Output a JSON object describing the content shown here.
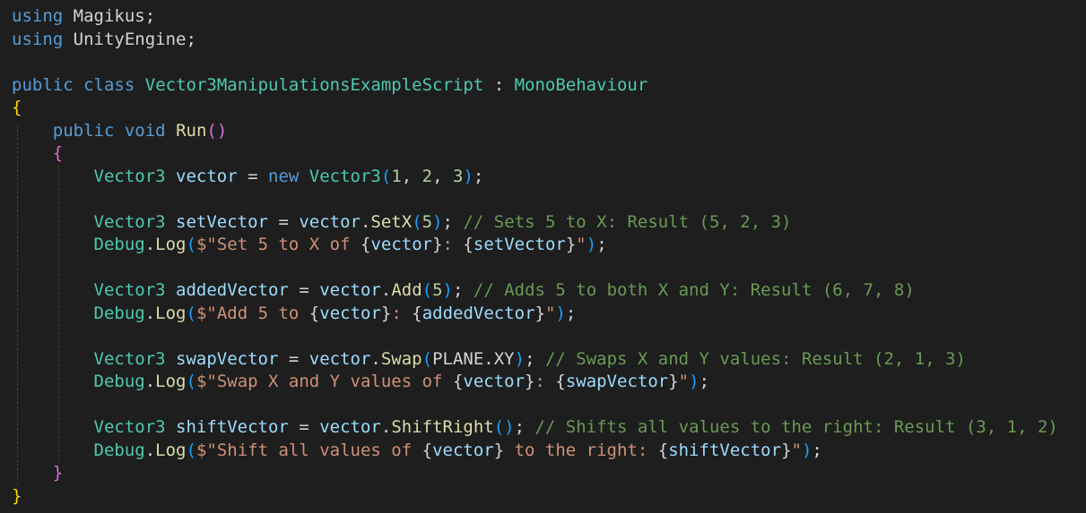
{
  "editor": {
    "background": "#1e1e1e",
    "language": "C#",
    "lines": [
      {
        "tokens": [
          {
            "t": "using",
            "c": "kw"
          },
          {
            "t": " Magikus",
            "c": "pu"
          },
          {
            "t": ";",
            "c": "pu"
          }
        ]
      },
      {
        "tokens": [
          {
            "t": "using",
            "c": "kw"
          },
          {
            "t": " UnityEngine",
            "c": "pu"
          },
          {
            "t": ";",
            "c": "pu"
          }
        ]
      },
      {
        "tokens": []
      },
      {
        "tokens": [
          {
            "t": "public",
            "c": "kw"
          },
          {
            "t": " ",
            "c": "pu"
          },
          {
            "t": "class",
            "c": "kw"
          },
          {
            "t": " ",
            "c": "pu"
          },
          {
            "t": "Vector3ManipulationsExampleScript",
            "c": "ty"
          },
          {
            "t": " : ",
            "c": "pu"
          },
          {
            "t": "MonoBehaviour",
            "c": "ty"
          }
        ]
      },
      {
        "tokens": [
          {
            "t": "{",
            "c": "br1"
          }
        ]
      },
      {
        "tokens": [
          {
            "t": "    ",
            "c": "pu"
          },
          {
            "t": "public",
            "c": "kw"
          },
          {
            "t": " ",
            "c": "pu"
          },
          {
            "t": "void",
            "c": "kw"
          },
          {
            "t": " ",
            "c": "pu"
          },
          {
            "t": "Run",
            "c": "fn"
          },
          {
            "t": "()",
            "c": "br2"
          }
        ]
      },
      {
        "tokens": [
          {
            "t": "    ",
            "c": "pu"
          },
          {
            "t": "{",
            "c": "br2"
          }
        ]
      },
      {
        "tokens": [
          {
            "t": "        ",
            "c": "pu"
          },
          {
            "t": "Vector3",
            "c": "ty"
          },
          {
            "t": " ",
            "c": "pu"
          },
          {
            "t": "vector",
            "c": "var"
          },
          {
            "t": " = ",
            "c": "pu"
          },
          {
            "t": "new",
            "c": "kw"
          },
          {
            "t": " ",
            "c": "pu"
          },
          {
            "t": "Vector3",
            "c": "ty"
          },
          {
            "t": "(",
            "c": "br3"
          },
          {
            "t": "1",
            "c": "num"
          },
          {
            "t": ", ",
            "c": "pu"
          },
          {
            "t": "2",
            "c": "num"
          },
          {
            "t": ", ",
            "c": "pu"
          },
          {
            "t": "3",
            "c": "num"
          },
          {
            "t": ")",
            "c": "br3"
          },
          {
            "t": ";",
            "c": "pu"
          }
        ]
      },
      {
        "tokens": []
      },
      {
        "tokens": [
          {
            "t": "        ",
            "c": "pu"
          },
          {
            "t": "Vector3",
            "c": "ty"
          },
          {
            "t": " ",
            "c": "pu"
          },
          {
            "t": "setVector",
            "c": "var"
          },
          {
            "t": " = ",
            "c": "pu"
          },
          {
            "t": "vector",
            "c": "var"
          },
          {
            "t": ".",
            "c": "pu"
          },
          {
            "t": "SetX",
            "c": "fn"
          },
          {
            "t": "(",
            "c": "br3"
          },
          {
            "t": "5",
            "c": "num"
          },
          {
            "t": ")",
            "c": "br3"
          },
          {
            "t": "; ",
            "c": "pu"
          },
          {
            "t": "// Sets 5 to X: Result (5, 2, 3)",
            "c": "cm"
          }
        ]
      },
      {
        "tokens": [
          {
            "t": "        ",
            "c": "pu"
          },
          {
            "t": "Debug",
            "c": "ty"
          },
          {
            "t": ".",
            "c": "pu"
          },
          {
            "t": "Log",
            "c": "fn"
          },
          {
            "t": "(",
            "c": "br3"
          },
          {
            "t": "$\"Set 5 to X of ",
            "c": "str"
          },
          {
            "t": "{",
            "c": "pu"
          },
          {
            "t": "vector",
            "c": "var"
          },
          {
            "t": "}",
            "c": "pu"
          },
          {
            "t": ": ",
            "c": "str"
          },
          {
            "t": "{",
            "c": "pu"
          },
          {
            "t": "setVector",
            "c": "var"
          },
          {
            "t": "}",
            "c": "pu"
          },
          {
            "t": "\"",
            "c": "str"
          },
          {
            "t": ")",
            "c": "br3"
          },
          {
            "t": ";",
            "c": "pu"
          }
        ]
      },
      {
        "tokens": []
      },
      {
        "tokens": [
          {
            "t": "        ",
            "c": "pu"
          },
          {
            "t": "Vector3",
            "c": "ty"
          },
          {
            "t": " ",
            "c": "pu"
          },
          {
            "t": "addedVector",
            "c": "var"
          },
          {
            "t": " = ",
            "c": "pu"
          },
          {
            "t": "vector",
            "c": "var"
          },
          {
            "t": ".",
            "c": "pu"
          },
          {
            "t": "Add",
            "c": "fn"
          },
          {
            "t": "(",
            "c": "br3"
          },
          {
            "t": "5",
            "c": "num"
          },
          {
            "t": ")",
            "c": "br3"
          },
          {
            "t": "; ",
            "c": "pu"
          },
          {
            "t": "// Adds 5 to both X and Y: Result (6, 7, 8)",
            "c": "cm"
          }
        ]
      },
      {
        "tokens": [
          {
            "t": "        ",
            "c": "pu"
          },
          {
            "t": "Debug",
            "c": "ty"
          },
          {
            "t": ".",
            "c": "pu"
          },
          {
            "t": "Log",
            "c": "fn"
          },
          {
            "t": "(",
            "c": "br3"
          },
          {
            "t": "$\"Add 5 to ",
            "c": "str"
          },
          {
            "t": "{",
            "c": "pu"
          },
          {
            "t": "vector",
            "c": "var"
          },
          {
            "t": "}",
            "c": "pu"
          },
          {
            "t": ": ",
            "c": "str"
          },
          {
            "t": "{",
            "c": "pu"
          },
          {
            "t": "addedVector",
            "c": "var"
          },
          {
            "t": "}",
            "c": "pu"
          },
          {
            "t": "\"",
            "c": "str"
          },
          {
            "t": ")",
            "c": "br3"
          },
          {
            "t": ";",
            "c": "pu"
          }
        ]
      },
      {
        "tokens": []
      },
      {
        "tokens": [
          {
            "t": "        ",
            "c": "pu"
          },
          {
            "t": "Vector3",
            "c": "ty"
          },
          {
            "t": " ",
            "c": "pu"
          },
          {
            "t": "swapVector",
            "c": "var"
          },
          {
            "t": " = ",
            "c": "pu"
          },
          {
            "t": "vector",
            "c": "var"
          },
          {
            "t": ".",
            "c": "pu"
          },
          {
            "t": "Swap",
            "c": "fn"
          },
          {
            "t": "(",
            "c": "br3"
          },
          {
            "t": "PLANE",
            "c": "pu"
          },
          {
            "t": ".",
            "c": "pu"
          },
          {
            "t": "XY",
            "c": "pu"
          },
          {
            "t": ")",
            "c": "br3"
          },
          {
            "t": "; ",
            "c": "pu"
          },
          {
            "t": "// Swaps X and Y values: Result (2, 1, 3)",
            "c": "cm"
          }
        ]
      },
      {
        "tokens": [
          {
            "t": "        ",
            "c": "pu"
          },
          {
            "t": "Debug",
            "c": "ty"
          },
          {
            "t": ".",
            "c": "pu"
          },
          {
            "t": "Log",
            "c": "fn"
          },
          {
            "t": "(",
            "c": "br3"
          },
          {
            "t": "$\"Swap X and Y values of ",
            "c": "str"
          },
          {
            "t": "{",
            "c": "pu"
          },
          {
            "t": "vector",
            "c": "var"
          },
          {
            "t": "}",
            "c": "pu"
          },
          {
            "t": ": ",
            "c": "str"
          },
          {
            "t": "{",
            "c": "pu"
          },
          {
            "t": "swapVector",
            "c": "var"
          },
          {
            "t": "}",
            "c": "pu"
          },
          {
            "t": "\"",
            "c": "str"
          },
          {
            "t": ")",
            "c": "br3"
          },
          {
            "t": ";",
            "c": "pu"
          }
        ]
      },
      {
        "tokens": []
      },
      {
        "tokens": [
          {
            "t": "        ",
            "c": "pu"
          },
          {
            "t": "Vector3",
            "c": "ty"
          },
          {
            "t": " ",
            "c": "pu"
          },
          {
            "t": "shiftVector",
            "c": "var"
          },
          {
            "t": " = ",
            "c": "pu"
          },
          {
            "t": "vector",
            "c": "var"
          },
          {
            "t": ".",
            "c": "pu"
          },
          {
            "t": "ShiftRight",
            "c": "fn"
          },
          {
            "t": "()",
            "c": "br3"
          },
          {
            "t": "; ",
            "c": "pu"
          },
          {
            "t": "// Shifts all values to the right: Result (3, 1, 2)",
            "c": "cm"
          }
        ]
      },
      {
        "tokens": [
          {
            "t": "        ",
            "c": "pu"
          },
          {
            "t": "Debug",
            "c": "ty"
          },
          {
            "t": ".",
            "c": "pu"
          },
          {
            "t": "Log",
            "c": "fn"
          },
          {
            "t": "(",
            "c": "br3"
          },
          {
            "t": "$\"Shift all values of ",
            "c": "str"
          },
          {
            "t": "{",
            "c": "pu"
          },
          {
            "t": "vector",
            "c": "var"
          },
          {
            "t": "}",
            "c": "pu"
          },
          {
            "t": " to the right: ",
            "c": "str"
          },
          {
            "t": "{",
            "c": "pu"
          },
          {
            "t": "shiftVector",
            "c": "var"
          },
          {
            "t": "}",
            "c": "pu"
          },
          {
            "t": "\"",
            "c": "str"
          },
          {
            "t": ")",
            "c": "br3"
          },
          {
            "t": ";",
            "c": "pu"
          }
        ]
      },
      {
        "tokens": [
          {
            "t": "    ",
            "c": "pu"
          },
          {
            "t": "}",
            "c": "br2"
          }
        ]
      },
      {
        "tokens": [
          {
            "t": "}",
            "c": "br1"
          }
        ]
      }
    ]
  }
}
